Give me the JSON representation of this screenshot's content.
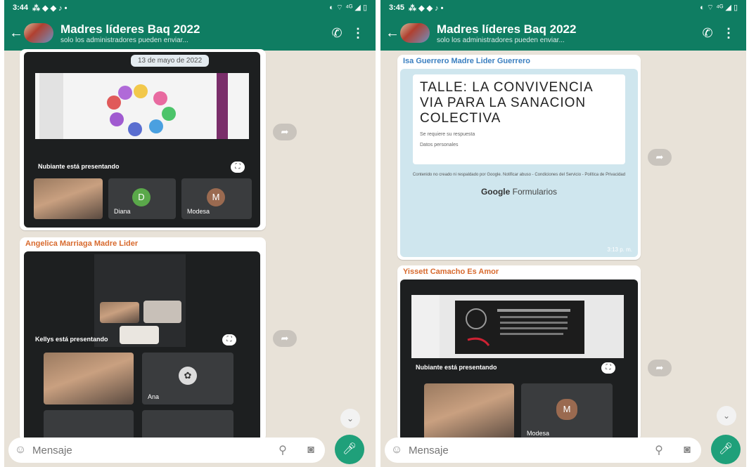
{
  "left": {
    "status_time": "3:44",
    "status_icons_left": "⁂ ◆ ◆ ♪ •",
    "status_icons_right": "◐ ⌔ ⁴ᴳ ◢ ▯",
    "title": "Madres líderes Baq 2022",
    "subtitle": "solo los administradores pueden enviar...",
    "date_chip": "13 de mayo de 2022",
    "presenting_1": "Nubiante está presentando",
    "tile_name_1": "Diana",
    "tile_name_2": "Modesa",
    "tile_initial_1": "D",
    "tile_initial_2": "M",
    "sender_2": "Angelica Marriaga Madre Lider",
    "presenting_2": "Kellys está presentando",
    "tile_name_3": "Ana",
    "composer_placeholder": "Mensaje"
  },
  "right": {
    "status_time": "3:45",
    "status_icons_left": "⁂ ◆ ◆ ♪ •",
    "status_icons_right": "◐ ⌔ ⁴ᴳ ◢ ▯",
    "title": "Madres líderes Baq 2022",
    "subtitle": "solo los administradores pueden enviar...",
    "sender_1": "Isa Guerrero Madre Lider Guerrero",
    "form_title": "TALLE: LA CONVIVENCIA VIA PARA LA SANACION COLECTIVA",
    "form_line_1": "Se requiere su respuesta",
    "form_line_2": "Datos personales",
    "form_footer": "Contenido no creado ni respaldado por Google. Notificar abuso - Condiciones del Servicio - Política de Privacidad",
    "google_brand": "Google",
    "forms_label": "Formularios",
    "time_1": "3:13 p. m.",
    "sender_2": "Yissett Camacho Es Amor",
    "presenting_1": "Nubiante está presentando",
    "tile_name_1": "Modesa",
    "tile_initial_1": "M",
    "composer_placeholder": "Mensaje"
  },
  "colors": {
    "header": "#0f7d62",
    "chat_bg": "#e8e2d8",
    "mic": "#1fa07a",
    "sender_orange": "#d86a2e",
    "form_bg": "#cfe6ee"
  }
}
